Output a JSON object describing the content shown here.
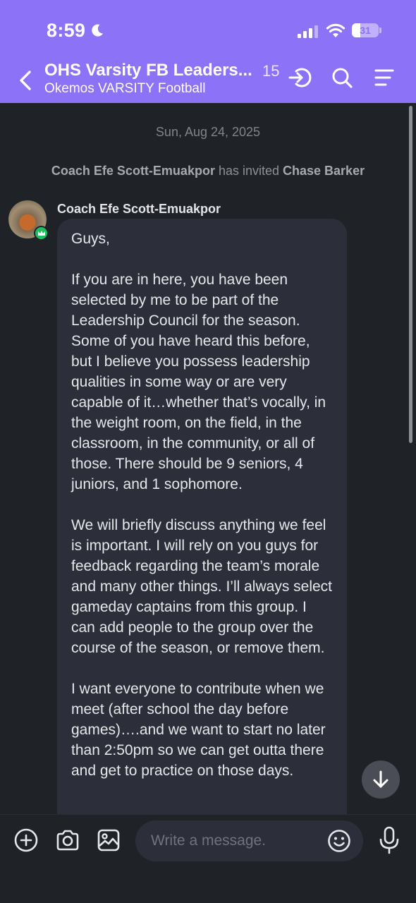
{
  "status_bar": {
    "time": "8:59",
    "battery_level": "31",
    "battery_fraction": 0.31
  },
  "header": {
    "title": "OHS Varsity FB Leaders...",
    "subtitle": "Okemos VARSITY Football",
    "member_count": "15",
    "icons": [
      "back-icon",
      "join-call-icon",
      "search-icon",
      "menu-icon"
    ]
  },
  "chat": {
    "date_separator": "Sun, Aug 24, 2025",
    "system_message": {
      "inviter": "Coach Efe Scott-Emuakpor",
      "action": " has invited ",
      "invitee": "Chase Barker"
    },
    "message": {
      "sender": "Coach Efe Scott-Emuakpor",
      "paragraphs": [
        "Guys,",
        "If you are in here, you have been selected by me to be part of the Leadership Council for the season. Some of you have heard this before, but I believe you possess leadership qualities in some way or are very capable of it…whether that’s vocally, in the weight room, on the field, in the classroom, in the community, or all of those. There should be 9 seniors, 4 juniors, and 1 sophomore.",
        "We will briefly discuss anything we feel is important. I will rely on you guys for feedback regarding the team’s morale and many other things. I’ll always select gameday captains from this group. I can add people to the group over the course of the season, or remove them.",
        "I want everyone to contribute when we meet (after school the day before games)….and we want to start no later than 2:50pm so we can get outta there and get to practice on those days."
      ]
    }
  },
  "composer": {
    "placeholder": "Write a message.",
    "icons": [
      "add-icon",
      "camera-icon",
      "gallery-icon",
      "emoji-icon",
      "microphone-icon"
    ]
  },
  "colors": {
    "header": "#8c72f6",
    "background": "#1f2227",
    "bubble": "#2c2f3a",
    "badge": "#1fbf5f"
  }
}
